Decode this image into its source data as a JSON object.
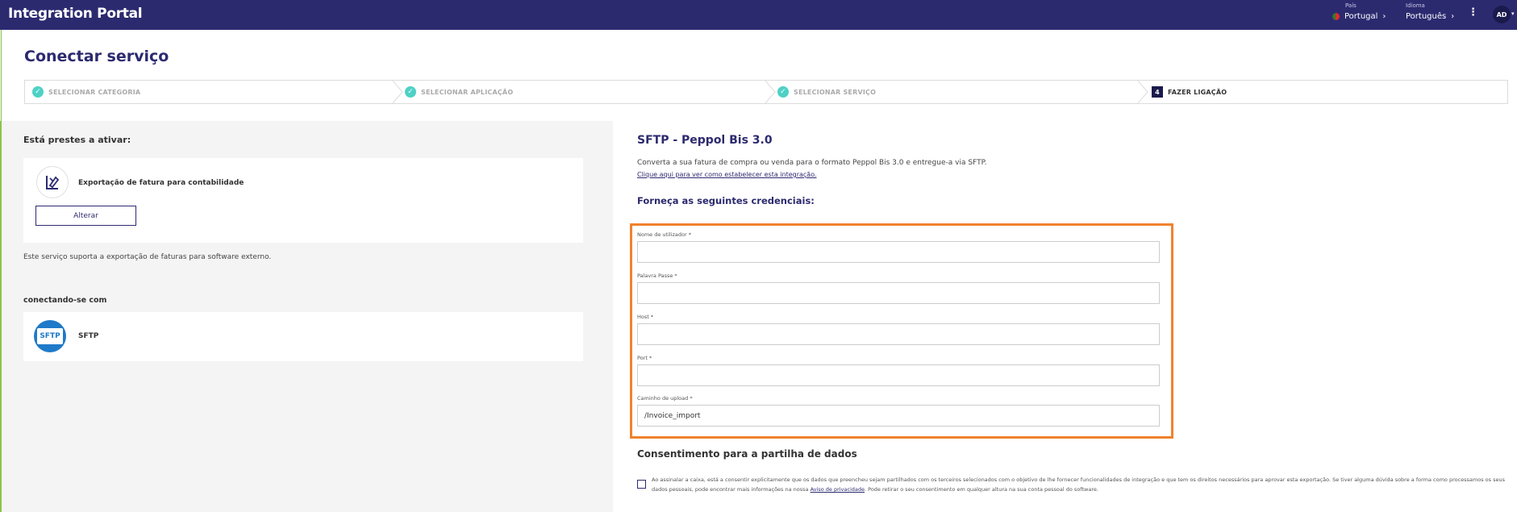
{
  "topbar": {
    "brand": "Integration Portal",
    "country_caption": "País",
    "country_value": "Portugal",
    "language_caption": "Idioma",
    "language_value": "Português",
    "avatar_initials": "AD",
    "menu_glyph": "⋮"
  },
  "page": {
    "title": "Conectar serviço"
  },
  "stepper": {
    "steps": [
      {
        "label": "SELECIONAR CATEGORIA",
        "state": "done",
        "marker": "✓"
      },
      {
        "label": "SELECIONAR APLICAÇÃO",
        "state": "done",
        "marker": "✓"
      },
      {
        "label": "SELECIONAR SERVIÇO",
        "state": "done",
        "marker": "✓"
      },
      {
        "label": "FAZER LIGAÇÃO",
        "state": "active",
        "marker": "4"
      }
    ]
  },
  "left": {
    "about_heading": "Está prestes a ativar:",
    "service_name": "Exportação de fatura para contabilidade",
    "change_button": "Alterar",
    "support_note": "Este serviço suporta a exportação de faturas para software externo.",
    "connecting_heading": "conectando-se com",
    "target_logo_text": "SFTP",
    "target_name": "SFTP"
  },
  "right": {
    "title": "SFTP - Peppol Bis 3.0",
    "description": "Converta a sua fatura de compra ou venda para o formato Peppol Bis 3.0 e entregue-a via SFTP.",
    "help_link": "Clique aqui para ver como estabelecer esta integração.",
    "credentials_heading": "Forneça as seguintes credenciais:",
    "fields": [
      {
        "label": "Nome de utilizador *",
        "value": ""
      },
      {
        "label": "Palavra Passe *",
        "value": ""
      },
      {
        "label": "Host *",
        "value": ""
      },
      {
        "label": "Port *",
        "value": ""
      },
      {
        "label": "Caminho de upload *",
        "value": "/Invoice_import"
      }
    ],
    "consent_heading": "Consentimento para a partilha de dados",
    "consent_text_1": "Ao assinalar a caixa, está a consentir explicitamente que os dados que preencheu sejam partilhados com os terceiros selecionados com o objetivo de lhe fornecer funcionalidades de integração e que tem os direitos necessários para aprovar esta exportação. Se tiver alguma dúvida sobre a forma como processamos os seus dados pessoais, pode encontrar mais informações na nossa ",
    "consent_link": "Aviso de privacidade",
    "consent_text_2": ". Pode retirar o seu consentimento em qualquer altura na sua conta pessoal do software."
  },
  "colors": {
    "brand": "#2c2a6f",
    "step_done": "#4fd1c5",
    "highlight": "#f0822d",
    "accent_border": "#8bc34a",
    "sftp_blue": "#1f7ac9"
  }
}
